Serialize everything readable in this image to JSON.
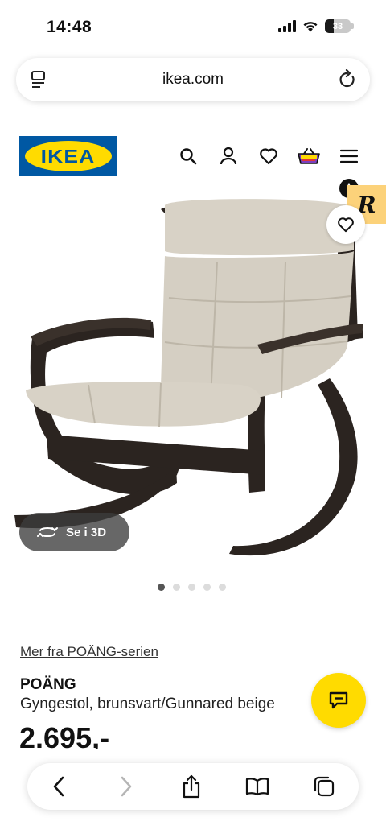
{
  "status_bar": {
    "time": "14:48",
    "battery": "33"
  },
  "browser": {
    "url": "ikea.com"
  },
  "header": {
    "logo_text": "IKEA"
  },
  "badges": {
    "extension_letter": "R",
    "info_letter": "i"
  },
  "gallery": {
    "view_3d_label": "Se i 3D",
    "dots": 5,
    "active_dot": 1
  },
  "product": {
    "series_link": "Mer fra POÄNG-serien",
    "name": "POÄNG",
    "description": "Gyngestol, brunsvart/Gunnared beige",
    "price": "2.695,-"
  },
  "colors": {
    "ikea_blue": "#0058a3",
    "ikea_yellow": "#ffdb00",
    "frame": "#2b2420",
    "cushion": "#d8d2c6"
  }
}
